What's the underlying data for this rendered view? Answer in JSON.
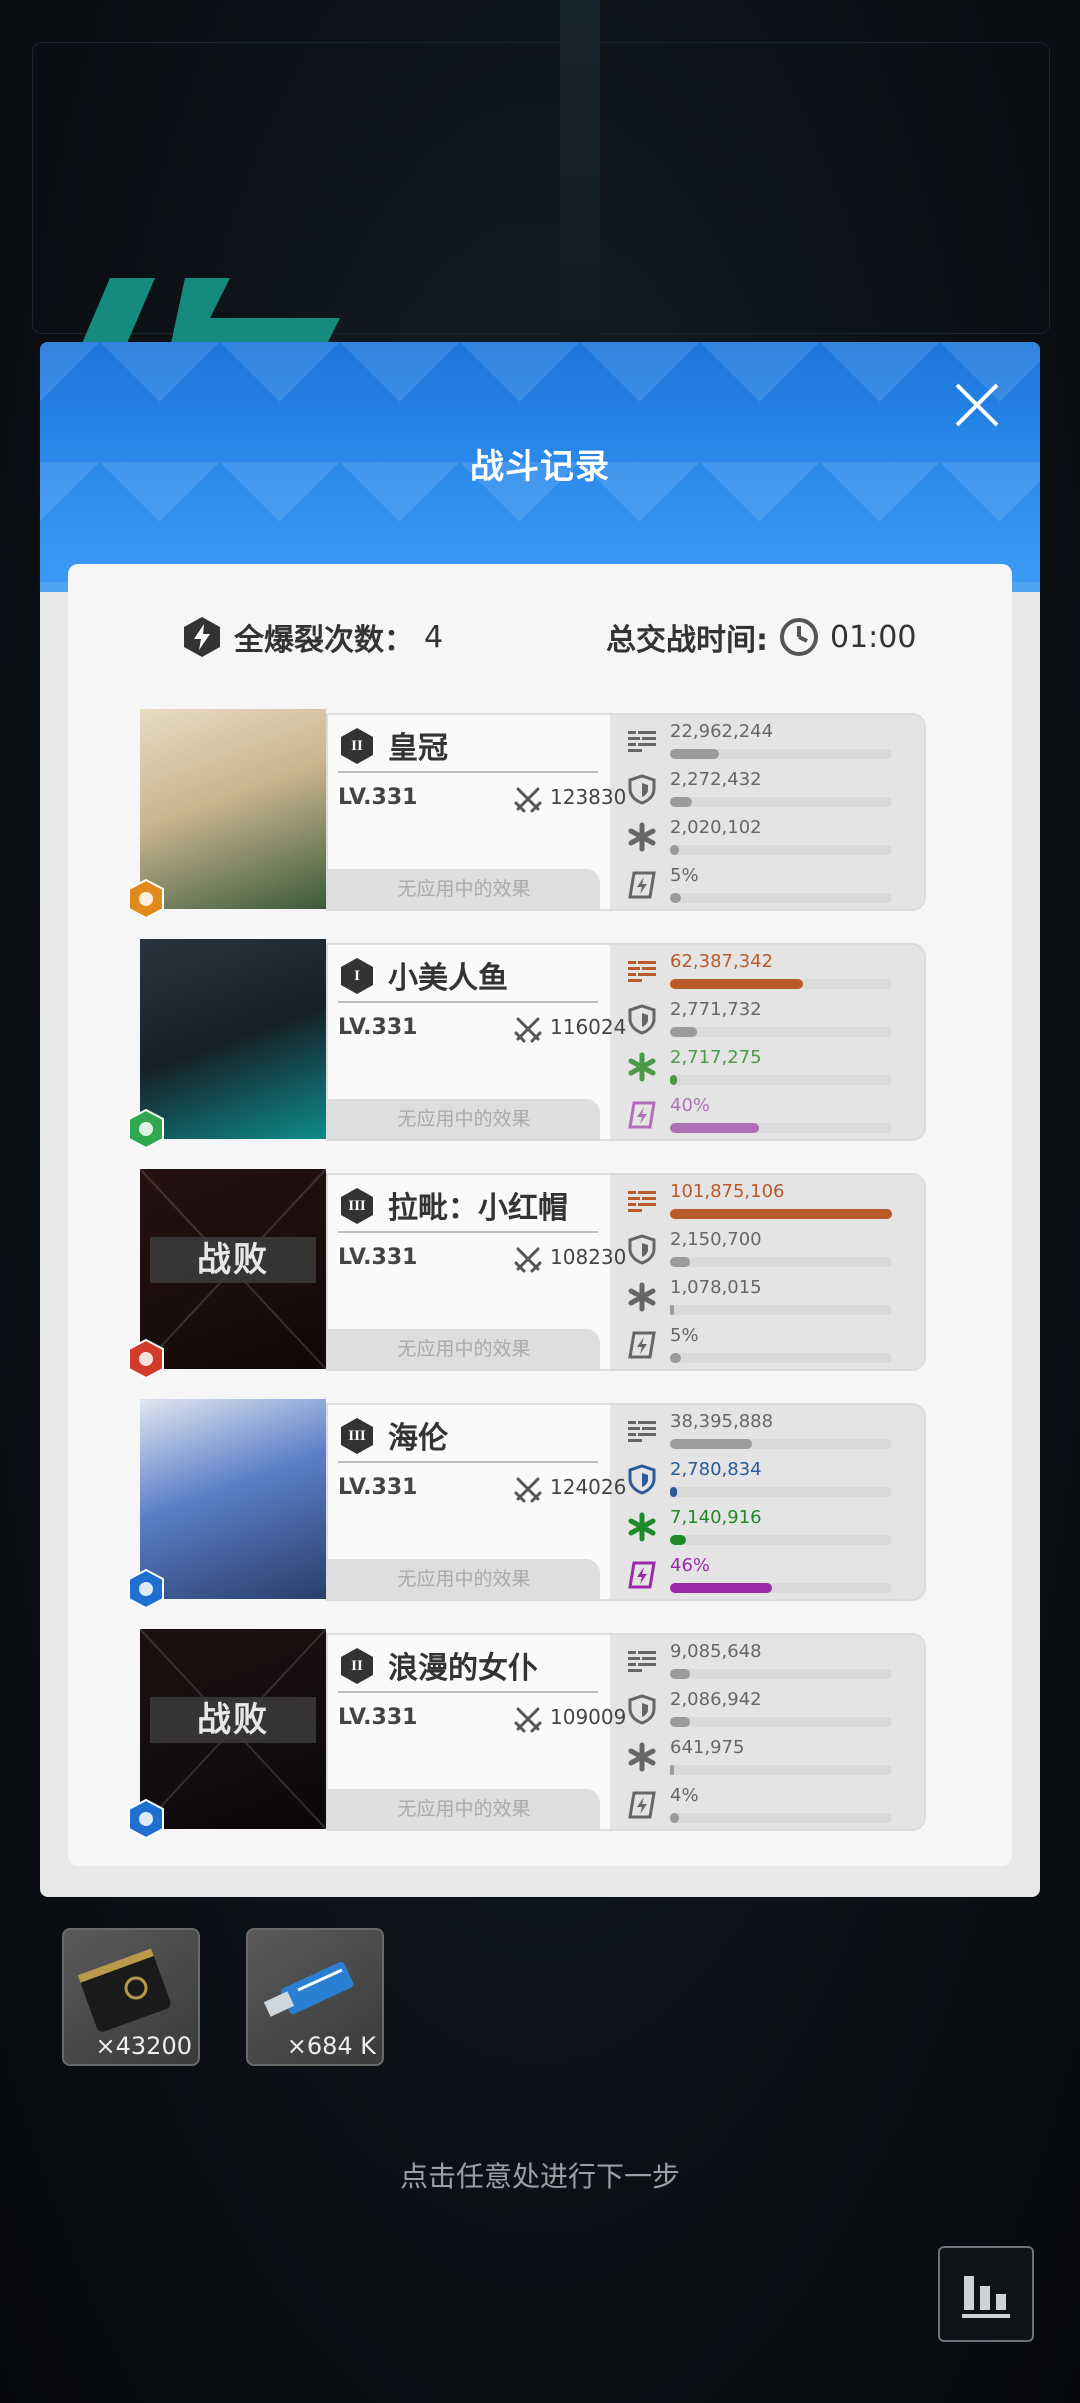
{
  "modal": {
    "title": "战斗记录"
  },
  "summary": {
    "burst_label": "全爆裂次数：",
    "burst_count": "4",
    "time_label": "总交战时间:",
    "time_value": "01:00"
  },
  "characters": [
    {
      "name": "皇冠",
      "tier": "II",
      "level": "LV.331",
      "power": "123830",
      "effect": "无应用中的效果",
      "defeated": false,
      "element": "iron",
      "element_color": "#e08a1c",
      "damage": "22,962,244",
      "damage_pct": 0.22,
      "taken": "2,272,432",
      "taken_pct": 0.1,
      "heal": "2,020,102",
      "heal_pct": 0.04,
      "burst": "5%",
      "burst_pct": 0.05,
      "highlight": false
    },
    {
      "name": "小美人鱼",
      "tier": "I",
      "level": "LV.331",
      "power": "116024",
      "effect": "无应用中的效果",
      "defeated": false,
      "element": "wind",
      "element_color": "#2fa84f",
      "damage": "62,387,342",
      "damage_pct": 0.6,
      "taken": "2,771,732",
      "taken_pct": 0.12,
      "heal": "2,717,275",
      "heal_pct": 0.03,
      "burst": "40%",
      "burst_pct": 0.4,
      "highlight": true,
      "colors": {
        "damage": "#b85a2a",
        "heal": "#4a9a4a",
        "burst": "#b070b8"
      }
    },
    {
      "name": "拉毗：小红帽",
      "tier": "III",
      "level": "LV.331",
      "power": "108230",
      "effect": "无应用中的效果",
      "defeated": true,
      "defeat_label": "战败",
      "element": "fire",
      "element_color": "#d23a2a",
      "damage": "101,875,106",
      "damage_pct": 1.0,
      "taken": "2,150,700",
      "taken_pct": 0.09,
      "heal": "1,078,015",
      "heal_pct": 0.02,
      "burst": "5%",
      "burst_pct": 0.05,
      "highlight": true,
      "colors": {
        "damage": "#b85a2a"
      }
    },
    {
      "name": "海伦",
      "tier": "III",
      "level": "LV.331",
      "power": "124026",
      "effect": "无应用中的效果",
      "defeated": false,
      "element": "water",
      "element_color": "#1d6fd0",
      "damage": "38,395,888",
      "damage_pct": 0.37,
      "taken": "2,780,834",
      "taken_pct": 0.03,
      "heal": "7,140,916",
      "heal_pct": 0.07,
      "burst": "46%",
      "burst_pct": 0.46,
      "highlight": true,
      "colors": {
        "taken": "#2a5a98",
        "heal": "#1f8a2a",
        "burst": "#9a2aa8"
      }
    },
    {
      "name": "浪漫的女仆",
      "tier": "II",
      "level": "LV.331",
      "power": "109009",
      "effect": "无应用中的效果",
      "defeated": true,
      "defeat_label": "战败",
      "element": "water",
      "element_color": "#1d6fd0",
      "damage": "9,085,648",
      "damage_pct": 0.09,
      "taken": "2,086,942",
      "taken_pct": 0.09,
      "heal": "641,975",
      "heal_pct": 0.02,
      "burst": "4%",
      "burst_pct": 0.04,
      "highlight": false
    }
  ],
  "rewards": [
    {
      "icon": "gold-card-icon",
      "count": "×43200"
    },
    {
      "icon": "usb-drive-icon",
      "count": "×684 K"
    }
  ],
  "hint": "点击任意处进行下一步",
  "colors": {
    "accent": "#2e8eee",
    "panel": "#f6f6f6"
  }
}
